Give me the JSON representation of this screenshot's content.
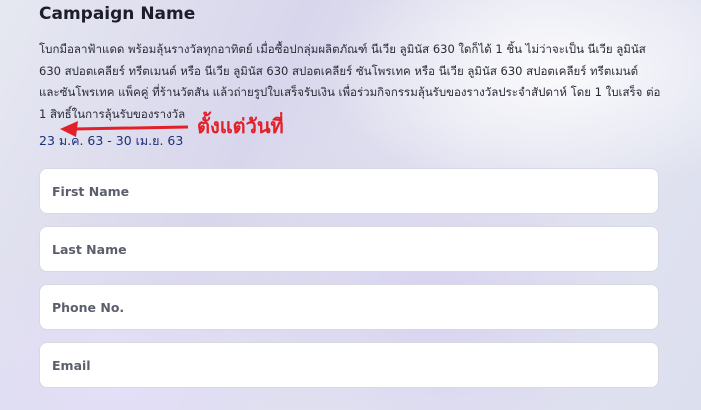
{
  "campaign": {
    "title": "Campaign Name",
    "description": "โบกมือลาฟ้าแดด พร้อมลุ้นรางวัลทุกอาทิตย์ เมื่อซื้อปกลุ่มผลิตภัณฑ์ นีเวีย ลูมินัส 630 ใดก็ได้ 1 ชิ้น ไม่ว่าจะเป็น นีเวีย ลูมินัส 630 สปอตเคลียร์ ทรีตเมนต์ หรือ นีเวีย ลูมินัส 630 สปอตเคลียร์ ซันโพรเทค หรือ นีเวีย ลูมินัส 630 สปอตเคลียร์ ทรีตเมนต์ และซันโพรเทค แพ็คคู่ ที่ร้านวัตสัน แล้วถ่ายรูปใบเสร็จรับเงิน เพื่อร่วมกิจกรรมลุ้นรับของรางวัลประจำสัปดาห์ โดย 1 ใบเสร็จ ต่อ 1 สิทธิ์ในการลุ้นรับของรางวัล",
    "dates": "23 ม.ค. 63 - 30 เม.ย. 63"
  },
  "annotation": {
    "text": "ตั้งแต่วันที่",
    "color": "#e2202a"
  },
  "form": {
    "first_name_placeholder": "First Name",
    "last_name_placeholder": "Last Name",
    "phone_placeholder": "Phone No.",
    "email_placeholder": "Email"
  }
}
